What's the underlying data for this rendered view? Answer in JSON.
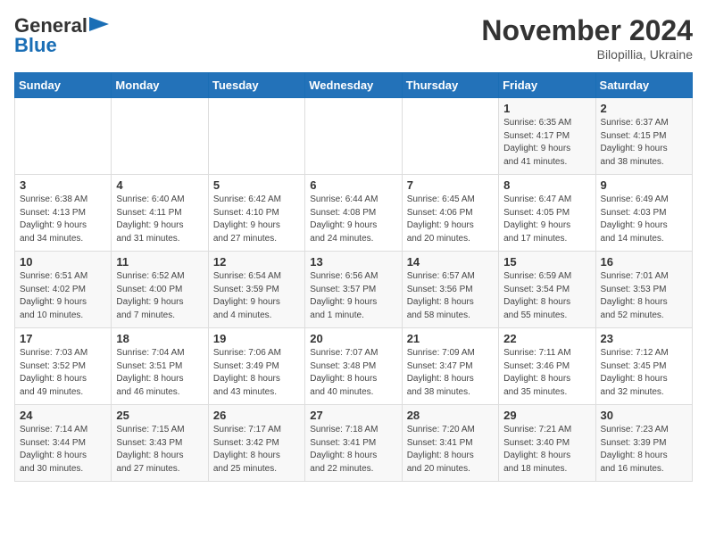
{
  "logo": {
    "general": "General",
    "blue": "Blue"
  },
  "title": "November 2024",
  "location": "Bilopillia, Ukraine",
  "days_of_week": [
    "Sunday",
    "Monday",
    "Tuesday",
    "Wednesday",
    "Thursday",
    "Friday",
    "Saturday"
  ],
  "weeks": [
    [
      {
        "day": "",
        "detail": ""
      },
      {
        "day": "",
        "detail": ""
      },
      {
        "day": "",
        "detail": ""
      },
      {
        "day": "",
        "detail": ""
      },
      {
        "day": "",
        "detail": ""
      },
      {
        "day": "1",
        "detail": "Sunrise: 6:35 AM\nSunset: 4:17 PM\nDaylight: 9 hours\nand 41 minutes."
      },
      {
        "day": "2",
        "detail": "Sunrise: 6:37 AM\nSunset: 4:15 PM\nDaylight: 9 hours\nand 38 minutes."
      }
    ],
    [
      {
        "day": "3",
        "detail": "Sunrise: 6:38 AM\nSunset: 4:13 PM\nDaylight: 9 hours\nand 34 minutes."
      },
      {
        "day": "4",
        "detail": "Sunrise: 6:40 AM\nSunset: 4:11 PM\nDaylight: 9 hours\nand 31 minutes."
      },
      {
        "day": "5",
        "detail": "Sunrise: 6:42 AM\nSunset: 4:10 PM\nDaylight: 9 hours\nand 27 minutes."
      },
      {
        "day": "6",
        "detail": "Sunrise: 6:44 AM\nSunset: 4:08 PM\nDaylight: 9 hours\nand 24 minutes."
      },
      {
        "day": "7",
        "detail": "Sunrise: 6:45 AM\nSunset: 4:06 PM\nDaylight: 9 hours\nand 20 minutes."
      },
      {
        "day": "8",
        "detail": "Sunrise: 6:47 AM\nSunset: 4:05 PM\nDaylight: 9 hours\nand 17 minutes."
      },
      {
        "day": "9",
        "detail": "Sunrise: 6:49 AM\nSunset: 4:03 PM\nDaylight: 9 hours\nand 14 minutes."
      }
    ],
    [
      {
        "day": "10",
        "detail": "Sunrise: 6:51 AM\nSunset: 4:02 PM\nDaylight: 9 hours\nand 10 minutes."
      },
      {
        "day": "11",
        "detail": "Sunrise: 6:52 AM\nSunset: 4:00 PM\nDaylight: 9 hours\nand 7 minutes."
      },
      {
        "day": "12",
        "detail": "Sunrise: 6:54 AM\nSunset: 3:59 PM\nDaylight: 9 hours\nand 4 minutes."
      },
      {
        "day": "13",
        "detail": "Sunrise: 6:56 AM\nSunset: 3:57 PM\nDaylight: 9 hours\nand 1 minute."
      },
      {
        "day": "14",
        "detail": "Sunrise: 6:57 AM\nSunset: 3:56 PM\nDaylight: 8 hours\nand 58 minutes."
      },
      {
        "day": "15",
        "detail": "Sunrise: 6:59 AM\nSunset: 3:54 PM\nDaylight: 8 hours\nand 55 minutes."
      },
      {
        "day": "16",
        "detail": "Sunrise: 7:01 AM\nSunset: 3:53 PM\nDaylight: 8 hours\nand 52 minutes."
      }
    ],
    [
      {
        "day": "17",
        "detail": "Sunrise: 7:03 AM\nSunset: 3:52 PM\nDaylight: 8 hours\nand 49 minutes."
      },
      {
        "day": "18",
        "detail": "Sunrise: 7:04 AM\nSunset: 3:51 PM\nDaylight: 8 hours\nand 46 minutes."
      },
      {
        "day": "19",
        "detail": "Sunrise: 7:06 AM\nSunset: 3:49 PM\nDaylight: 8 hours\nand 43 minutes."
      },
      {
        "day": "20",
        "detail": "Sunrise: 7:07 AM\nSunset: 3:48 PM\nDaylight: 8 hours\nand 40 minutes."
      },
      {
        "day": "21",
        "detail": "Sunrise: 7:09 AM\nSunset: 3:47 PM\nDaylight: 8 hours\nand 38 minutes."
      },
      {
        "day": "22",
        "detail": "Sunrise: 7:11 AM\nSunset: 3:46 PM\nDaylight: 8 hours\nand 35 minutes."
      },
      {
        "day": "23",
        "detail": "Sunrise: 7:12 AM\nSunset: 3:45 PM\nDaylight: 8 hours\nand 32 minutes."
      }
    ],
    [
      {
        "day": "24",
        "detail": "Sunrise: 7:14 AM\nSunset: 3:44 PM\nDaylight: 8 hours\nand 30 minutes."
      },
      {
        "day": "25",
        "detail": "Sunrise: 7:15 AM\nSunset: 3:43 PM\nDaylight: 8 hours\nand 27 minutes."
      },
      {
        "day": "26",
        "detail": "Sunrise: 7:17 AM\nSunset: 3:42 PM\nDaylight: 8 hours\nand 25 minutes."
      },
      {
        "day": "27",
        "detail": "Sunrise: 7:18 AM\nSunset: 3:41 PM\nDaylight: 8 hours\nand 22 minutes."
      },
      {
        "day": "28",
        "detail": "Sunrise: 7:20 AM\nSunset: 3:41 PM\nDaylight: 8 hours\nand 20 minutes."
      },
      {
        "day": "29",
        "detail": "Sunrise: 7:21 AM\nSunset: 3:40 PM\nDaylight: 8 hours\nand 18 minutes."
      },
      {
        "day": "30",
        "detail": "Sunrise: 7:23 AM\nSunset: 3:39 PM\nDaylight: 8 hours\nand 16 minutes."
      }
    ]
  ]
}
